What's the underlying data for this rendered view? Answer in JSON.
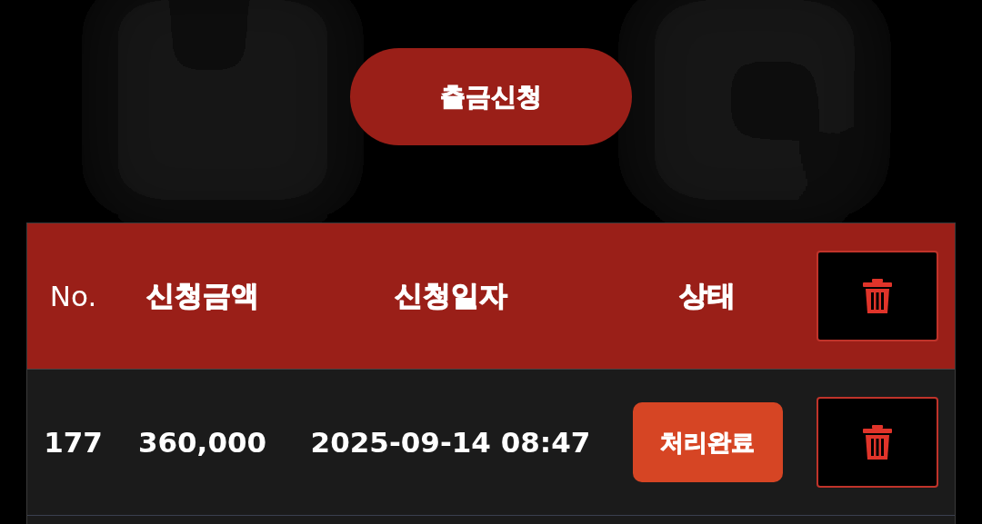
{
  "withdraw_button": {
    "label": "출금신청"
  },
  "table": {
    "columns": [
      {
        "kind": "text",
        "label": "No.",
        "bold": false
      },
      {
        "kind": "text",
        "label": "신청금액",
        "bold": true
      },
      {
        "kind": "text",
        "label": "신청일자",
        "bold": true
      },
      {
        "kind": "text",
        "label": "상태",
        "bold": true
      },
      {
        "kind": "delete"
      }
    ],
    "rows": [
      {
        "no": "177",
        "amount": "360,000",
        "date": "2025-09-14 08:47",
        "status": "처리완료"
      }
    ]
  }
}
